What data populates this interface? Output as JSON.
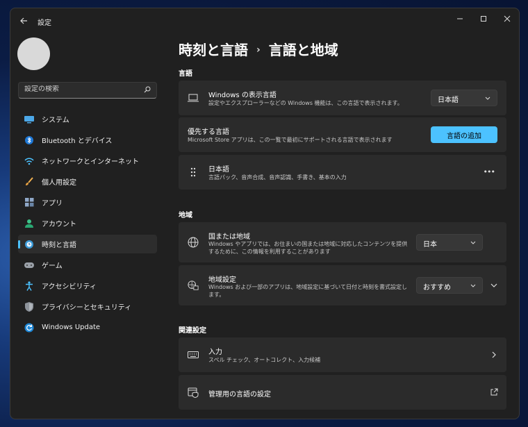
{
  "window": {
    "title": "設定"
  },
  "search": {
    "placeholder": "設定の検索"
  },
  "nav": [
    {
      "label": "システム",
      "icon": "monitor-icon"
    },
    {
      "label": "Bluetooth とデバイス",
      "icon": "bluetooth-icon"
    },
    {
      "label": "ネットワークとインターネット",
      "icon": "wifi-icon"
    },
    {
      "label": "個人用設定",
      "icon": "brush-icon"
    },
    {
      "label": "アプリ",
      "icon": "apps-icon"
    },
    {
      "label": "アカウント",
      "icon": "person-icon"
    },
    {
      "label": "時刻と言語",
      "icon": "globe-clock-icon",
      "active": true
    },
    {
      "label": "ゲーム",
      "icon": "gamepad-icon"
    },
    {
      "label": "アクセシビリティ",
      "icon": "accessibility-icon"
    },
    {
      "label": "プライバシーとセキュリティ",
      "icon": "shield-icon"
    },
    {
      "label": "Windows Update",
      "icon": "update-icon"
    }
  ],
  "breadcrumb": {
    "parent": "時刻と言語",
    "separator": "›",
    "current": "言語と地域"
  },
  "language": {
    "heading": "言語",
    "display": {
      "title": "Windows の表示言語",
      "subtitle": "設定やエクスプローラーなどの Windows 機能は、この言語で表示されます。",
      "value": "日本語"
    },
    "preferred": {
      "title": "優先する言語",
      "subtitle": "Microsoft Store アプリは、この一覧で最初にサポートされる言語で表示されます",
      "button": "言語の追加"
    },
    "japanese": {
      "title": "日本語",
      "subtitle": "言語パック、音声合成、音声認識、手書き、基本の入力",
      "more": "•••"
    }
  },
  "region": {
    "heading": "地域",
    "country": {
      "title": "国または地域",
      "subtitle": "Windows やアプリでは、お住まいの国または地域に対応したコンテンツを提供するために、この情報を利用することがあります",
      "value": "日本"
    },
    "format": {
      "title": "地域設定",
      "subtitle": "Windows および一部のアプリは、地域設定に基づいて日付と時刻を書式設定します。",
      "value": "おすすめ"
    }
  },
  "related": {
    "heading": "関連設定",
    "typing": {
      "title": "入力",
      "subtitle": "スペル チェック、オートコレクト、入力候補"
    },
    "admin": {
      "title": "管理用の言語の設定"
    }
  },
  "colors": {
    "accent": "#4cc2ff",
    "window_bg": "#202020",
    "card_bg": "#2b2b2b"
  }
}
